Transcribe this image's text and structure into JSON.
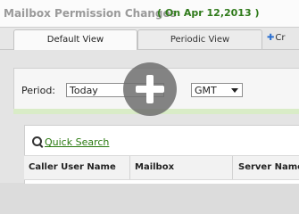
{
  "header": {
    "title": "Mailbox Permission Changes",
    "date_label": "( On Apr 12,2013 )"
  },
  "tabs": [
    {
      "label": "Default View",
      "active": true
    },
    {
      "label": "Periodic View",
      "active": false
    }
  ],
  "new_tab": {
    "label": "Cr"
  },
  "filters": {
    "period_label": "Period:",
    "period_value": "Today",
    "timezone_value": "GMT"
  },
  "quick_search": {
    "label": "Quick Search",
    "icon": "search-icon"
  },
  "table": {
    "columns": [
      "Caller User Name",
      "Mailbox",
      "Server Name"
    ]
  },
  "overlay": {
    "icon": "plus-icon"
  },
  "colors": {
    "accent_green": "#2f7a1a",
    "link_green": "#2a7a10",
    "overlay_gray": "#6e6e6e"
  }
}
